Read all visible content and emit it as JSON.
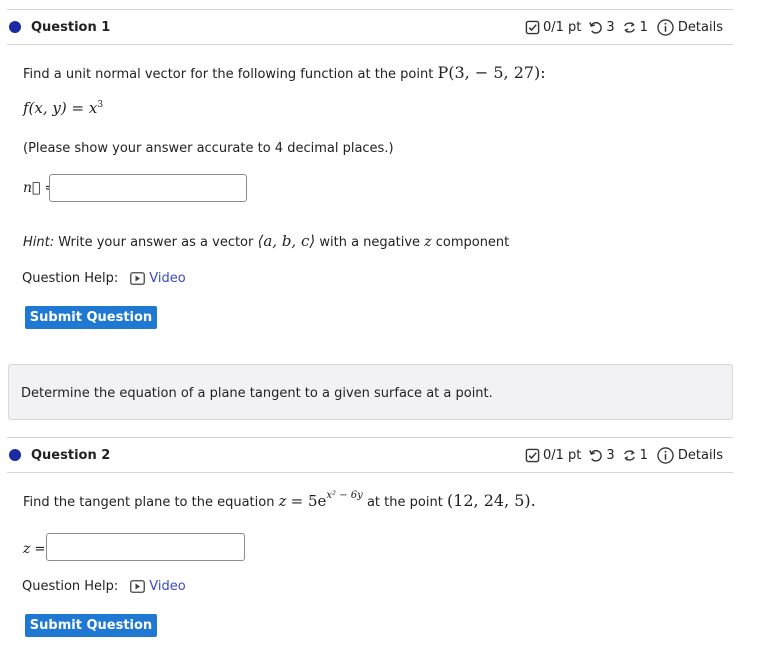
{
  "q1": {
    "title": "Question 1",
    "score": "0/1 pt",
    "attempts": "3",
    "retries": "1",
    "details": "Details",
    "prompt": "Find a unit normal vector for the following function at the point",
    "point": "P(3, − 5, 27):",
    "function_lhs": "f(x, y)",
    "function_rhs": "= x",
    "function_exp": "3",
    "instruction": "(Please show your answer accurate to 4 decimal places.)",
    "answer_label_var": "n⃗",
    "answer_label_eq": "=",
    "answer_value": "",
    "hint_label": "Hint:",
    "hint_text_a": "Write your answer as a vector",
    "hint_vector": "⟨a, b, c⟩",
    "hint_text_b": "with a negative",
    "hint_var": "z",
    "hint_text_c": "component",
    "help_label": "Question Help:",
    "video_label": "Video",
    "submit_label": "Submit Question"
  },
  "info": {
    "text": "Determine the equation of a plane tangent to a given surface at a point."
  },
  "q2": {
    "title": "Question 2",
    "score": "0/1 pt",
    "attempts": "3",
    "retries": "1",
    "details": "Details",
    "prompt": "Find the tangent plane to the equation",
    "equation_lhs": "z",
    "equation_eq": "= 5e",
    "equation_exp": "x² − 6y",
    "point_text": "at the point",
    "point": "(12, 24, 5).",
    "answer_label_var": "z",
    "answer_label_eq": "=",
    "answer_value": "",
    "help_label": "Question Help:",
    "video_label": "Video",
    "submit_label": "Submit Question"
  },
  "colors": {
    "dot": "#1c2aa3",
    "button": "#1f78d1",
    "link": "#3a49c7"
  }
}
